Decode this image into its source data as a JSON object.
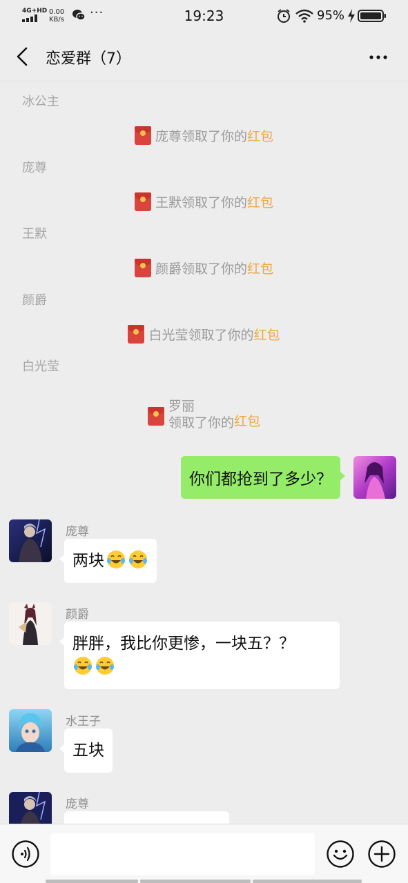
{
  "status_bar": {
    "network": "4G+HD",
    "speed_value": "0.00",
    "speed_unit": "KB/s",
    "time": "19:23",
    "battery_percent": "95%"
  },
  "nav": {
    "title": "恋爱群（7）"
  },
  "notices": [
    {
      "sender": "冰公主",
      "receiver_text": "庞尊领取了你的",
      "link": "红包"
    },
    {
      "sender": "庞尊",
      "receiver_text": "王默领取了你的",
      "link": "红包"
    },
    {
      "sender": "王默",
      "receiver_text": "颜爵领取了你的",
      "link": "红包"
    },
    {
      "sender": "颜爵",
      "receiver_text": "白光莹领取了你的",
      "link": "红包"
    },
    {
      "sender": "白光莹",
      "receiver_line1": "罗丽",
      "receiver_line2": "领取了你的",
      "link": "红包"
    }
  ],
  "messages": {
    "me": {
      "text": "你们都抢到了多少？"
    },
    "m1": {
      "sender": "庞尊",
      "text": "两块"
    },
    "m2": {
      "sender": "颜爵",
      "line1": "胖胖，我比你更惨，一块五？？"
    },
    "m3": {
      "sender": "水王子",
      "text": "五块"
    },
    "m4": {
      "sender": "庞尊"
    }
  },
  "input": {
    "placeholder": ""
  },
  "colors": {
    "background": "#ededed",
    "bubble_self": "#95ec69",
    "bubble_other": "#ffffff",
    "red_packet": "#d9443c",
    "red_packet_link": "#f0a742"
  },
  "icons": {
    "emoji_in_messages": "laughing-tears-emoji"
  }
}
